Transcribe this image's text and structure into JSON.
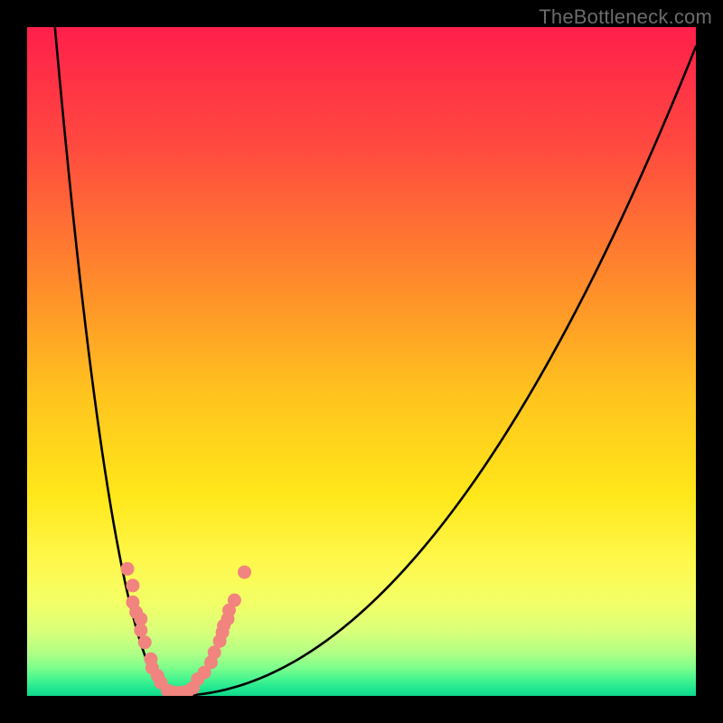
{
  "watermark": "TheBottleneck.com",
  "colors": {
    "frame": "#000000",
    "curve": "#000000",
    "point_fill": "#f1847e",
    "point_stroke": "#e36a64",
    "gradient_stops": [
      {
        "offset": 0.0,
        "color": "#ff1f4b"
      },
      {
        "offset": 0.18,
        "color": "#ff4a3f"
      },
      {
        "offset": 0.38,
        "color": "#ff8a2b"
      },
      {
        "offset": 0.55,
        "color": "#ffc41e"
      },
      {
        "offset": 0.7,
        "color": "#ffe71a"
      },
      {
        "offset": 0.8,
        "color": "#fff84d"
      },
      {
        "offset": 0.86,
        "color": "#f3ff66"
      },
      {
        "offset": 0.905,
        "color": "#d8ff7a"
      },
      {
        "offset": 0.935,
        "color": "#b2ff86"
      },
      {
        "offset": 0.958,
        "color": "#7dff8c"
      },
      {
        "offset": 0.975,
        "color": "#46f58f"
      },
      {
        "offset": 0.99,
        "color": "#1ee590"
      },
      {
        "offset": 1.0,
        "color": "#0fd98c"
      }
    ]
  },
  "chart_data": {
    "type": "line",
    "title": "",
    "xlabel": "",
    "ylabel": "",
    "x_range": [
      0,
      100
    ],
    "y_range": [
      0,
      100
    ],
    "curve": {
      "xmin_pct": 22,
      "a_left": 0.3142,
      "a_right": 0.01596,
      "note": "V-shaped bottleneck curve; minimum at x≈22%, y=0; left branch rises steeply to y≈100 at x=0, right branch rises toward y≈97 at x=100."
    },
    "series": [
      {
        "name": "data-points",
        "points": [
          {
            "x": 15.0,
            "y": 19.0
          },
          {
            "x": 15.8,
            "y": 16.5
          },
          {
            "x": 15.8,
            "y": 14.0
          },
          {
            "x": 16.3,
            "y": 12.5
          },
          {
            "x": 17.0,
            "y": 11.5
          },
          {
            "x": 17.0,
            "y": 9.8
          },
          {
            "x": 17.6,
            "y": 8.0
          },
          {
            "x": 18.5,
            "y": 5.5
          },
          {
            "x": 18.7,
            "y": 4.2
          },
          {
            "x": 19.5,
            "y": 3.0
          },
          {
            "x": 20.0,
            "y": 2.0
          },
          {
            "x": 21.0,
            "y": 0.8
          },
          {
            "x": 22.0,
            "y": 0.5
          },
          {
            "x": 23.0,
            "y": 0.5
          },
          {
            "x": 24.0,
            "y": 0.7
          },
          {
            "x": 24.8,
            "y": 1.2
          },
          {
            "x": 25.5,
            "y": 2.5
          },
          {
            "x": 26.5,
            "y": 3.5
          },
          {
            "x": 27.5,
            "y": 5.0
          },
          {
            "x": 28.0,
            "y": 6.5
          },
          {
            "x": 28.8,
            "y": 8.2
          },
          {
            "x": 29.2,
            "y": 9.5
          },
          {
            "x": 29.4,
            "y": 10.5
          },
          {
            "x": 30.0,
            "y": 11.5
          },
          {
            "x": 30.2,
            "y": 12.8
          },
          {
            "x": 31.0,
            "y": 14.3
          },
          {
            "x": 32.5,
            "y": 18.5
          }
        ]
      }
    ]
  }
}
